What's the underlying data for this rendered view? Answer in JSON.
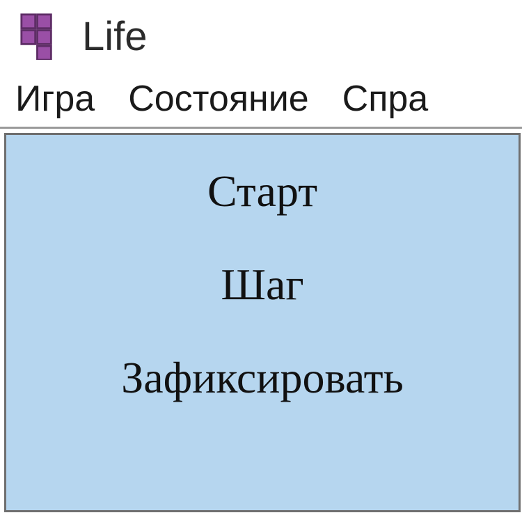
{
  "titlebar": {
    "title": "Life",
    "icon": "tetromino-icon",
    "icon_color": "#9a4fa6"
  },
  "menubar": {
    "items": [
      {
        "label": "Игра"
      },
      {
        "label": "Состояние"
      },
      {
        "label": "Спра"
      }
    ]
  },
  "panel": {
    "bg": "#b6d6ef",
    "actions": [
      {
        "label": "Старт"
      },
      {
        "label": "Шаг"
      },
      {
        "label": "Зафиксировать"
      }
    ]
  }
}
